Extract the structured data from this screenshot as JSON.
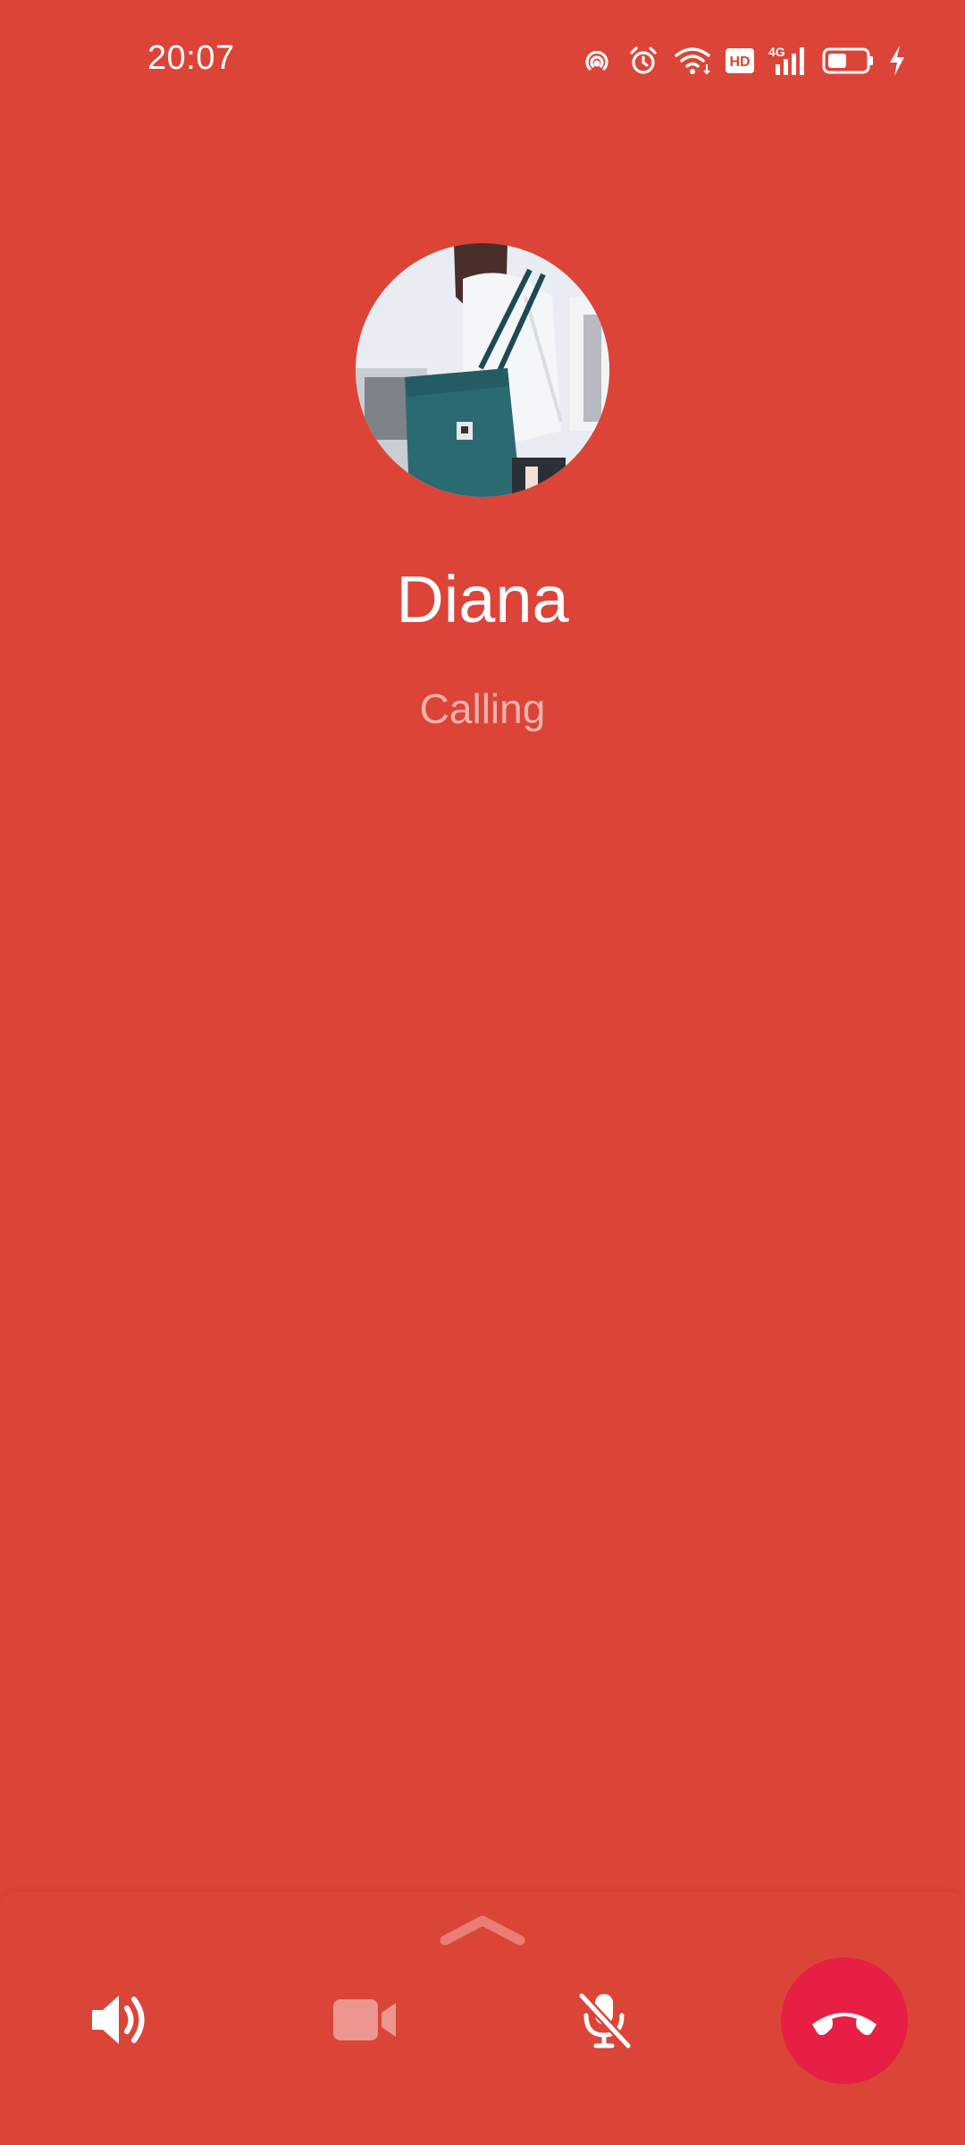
{
  "status_bar": {
    "time": "20:07",
    "icons": [
      "hotspot-icon",
      "alarm-icon",
      "wifi-icon",
      "hd-icon",
      "signal-4g-icon",
      "battery-icon",
      "charging-icon"
    ],
    "hd_label": "HD",
    "network_label": "4G"
  },
  "call": {
    "caller_name": "Diana",
    "status": "Calling"
  },
  "controls": {
    "icons": [
      "speaker-icon",
      "video-camera-icon",
      "mic-off-icon",
      "end-call-icon"
    ]
  },
  "colors": {
    "background": "#DC4437",
    "end_call": "#E81F45",
    "status_text": "#F2B3AC"
  }
}
